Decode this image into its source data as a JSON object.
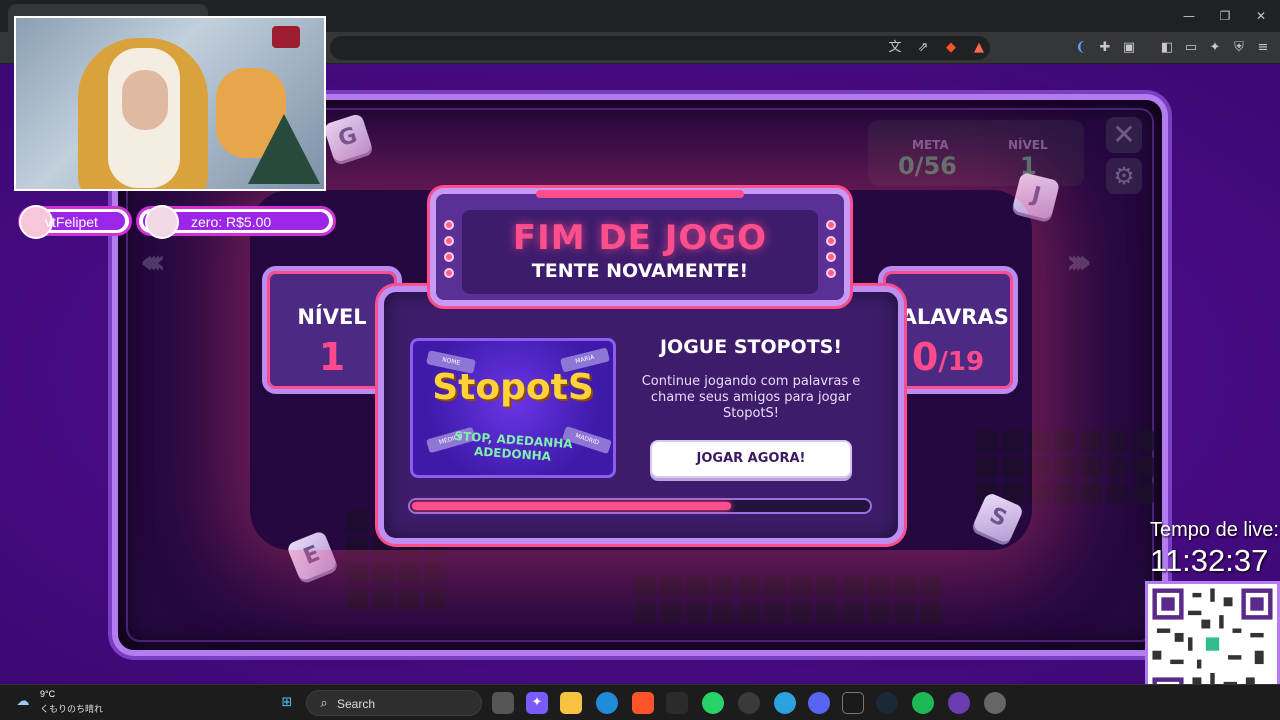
{
  "browser": {
    "tab_title": "",
    "window_controls": [
      "—",
      "❐",
      "✕"
    ]
  },
  "game": {
    "hud": {
      "meta_label": "META",
      "meta_value": "0/56",
      "nivel_label": "NÍVEL",
      "nivel_value": "1"
    },
    "dice_letters": [
      "G",
      "J",
      "S",
      "E"
    ],
    "modal": {
      "title": "FIM DE JOGO",
      "subtitle": "TENTE NOVAMENTE!",
      "level_label": "NÍVEL",
      "level_value": "1",
      "words_label": "PALAVRAS",
      "words_found": "0",
      "words_total": "/19",
      "promo": {
        "logo": "StopotS",
        "tagline_1": "STOP, ADEDANHA",
        "tagline_2": "ADEDONHA",
        "tickets": [
          "NOME",
          "MARIA",
          "MÉDICO",
          "MADRID"
        ]
      },
      "cta_title": "JOGUE STOPOTS!",
      "cta_text": "Continue jogando com palavras e chame seus amigos para jogar StopotS!",
      "cta_button": "JOGAR AGORA!",
      "progress": 0.7
    }
  },
  "stream": {
    "user_pill": "vtFelipet",
    "donation_pill": "zero: R$5.00",
    "timer_label": "Tempo de live:",
    "timer_value": "11:32:37"
  },
  "taskbar": {
    "weather_temp": "9°C",
    "weather_desc": "くもりのち晴れ",
    "search_label": "Search",
    "colors": {
      "accent_pink": "#ff4d8d",
      "panel_purple": "#3d1d6b",
      "border_lilac": "#bd8ff2"
    }
  }
}
